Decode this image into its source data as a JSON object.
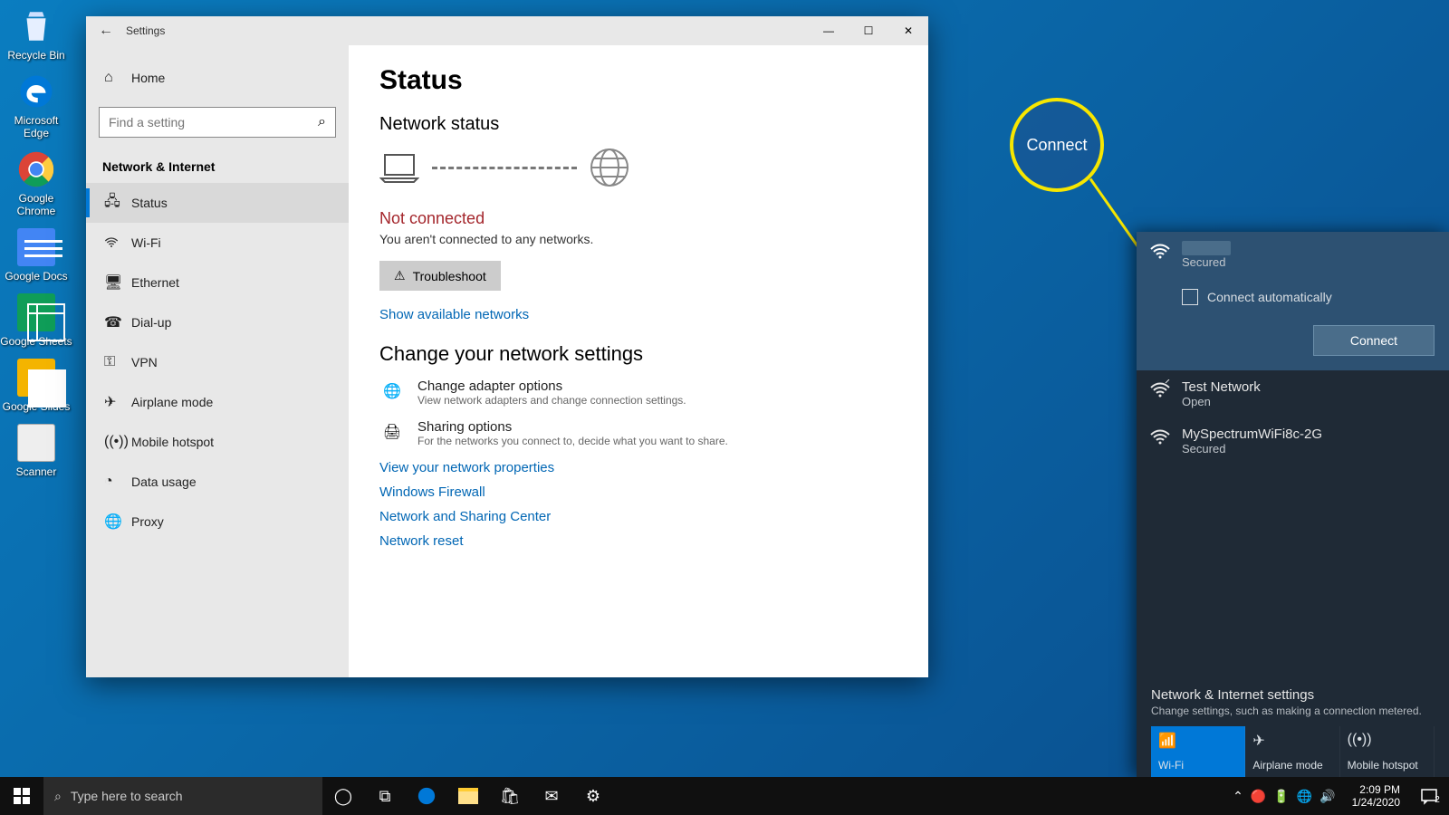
{
  "desktop": {
    "icons": [
      {
        "label": "Recycle Bin",
        "icon": "recycle-bin"
      },
      {
        "label": "Microsoft Edge",
        "icon": "edge"
      },
      {
        "label": "Google Chrome",
        "icon": "chrome"
      },
      {
        "label": "Google Docs",
        "icon": "gdocs"
      },
      {
        "label": "Google Sheets",
        "icon": "gsheets"
      },
      {
        "label": "Google Slides",
        "icon": "gslides"
      },
      {
        "label": "Scanner",
        "icon": "scanner"
      }
    ]
  },
  "settings": {
    "title": "Settings",
    "home": "Home",
    "search_placeholder": "Find a setting",
    "section": "Network & Internet",
    "nav": [
      {
        "label": "Status",
        "icon": "status",
        "selected": true
      },
      {
        "label": "Wi-Fi",
        "icon": "wifi"
      },
      {
        "label": "Ethernet",
        "icon": "ethernet"
      },
      {
        "label": "Dial-up",
        "icon": "dialup"
      },
      {
        "label": "VPN",
        "icon": "vpn"
      },
      {
        "label": "Airplane mode",
        "icon": "airplane"
      },
      {
        "label": "Mobile hotspot",
        "icon": "hotspot"
      },
      {
        "label": "Data usage",
        "icon": "datausage"
      },
      {
        "label": "Proxy",
        "icon": "proxy"
      }
    ],
    "content": {
      "heading": "Status",
      "network_status": "Network status",
      "not_connected": "Not connected",
      "not_connected_sub": "You aren't connected to any networks.",
      "troubleshoot": "Troubleshoot",
      "show_available": "Show available networks",
      "change_heading": "Change your network settings",
      "adapter_title": "Change adapter options",
      "adapter_sub": "View network adapters and change connection settings.",
      "sharing_title": "Sharing options",
      "sharing_sub": "For the networks you connect to, decide what you want to share.",
      "links": [
        "View your network properties",
        "Windows Firewall",
        "Network and Sharing Center",
        "Network reset"
      ]
    }
  },
  "callout": {
    "label": "Connect"
  },
  "wifi_flyout": {
    "active": {
      "name": "",
      "security": "Secured",
      "auto_label": "Connect automatically",
      "connect": "Connect"
    },
    "networks": [
      {
        "name": "Test Network",
        "security": "Open",
        "icon": "wifi-open"
      },
      {
        "name": "MySpectrumWiFi8c-2G",
        "security": "Secured",
        "icon": "wifi-secure"
      }
    ],
    "footer_title": "Network & Internet settings",
    "footer_sub": "Change settings, such as making a connection metered.",
    "tiles": [
      {
        "label": "Wi-Fi",
        "on": true,
        "icon": "wifi"
      },
      {
        "label": "Airplane mode",
        "on": false,
        "icon": "airplane"
      },
      {
        "label": "Mobile hotspot",
        "on": false,
        "icon": "hotspot"
      }
    ]
  },
  "taskbar": {
    "search_placeholder": "Type here to search",
    "time": "2:09 PM",
    "date": "1/24/2020",
    "notif_count": "2"
  }
}
